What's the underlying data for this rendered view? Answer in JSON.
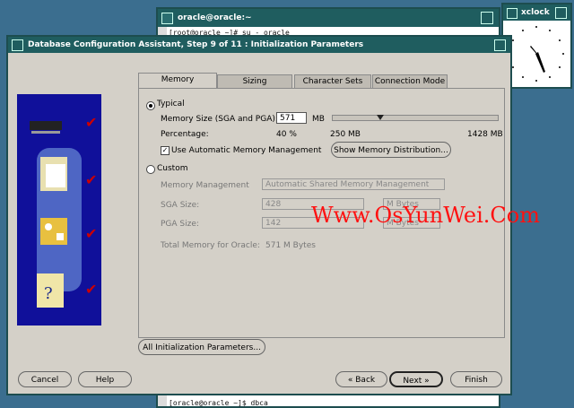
{
  "terminal": {
    "title": "oracle@oracle:~",
    "line1": "[root@oracle ~]# su - oracle",
    "prompt_line": "[oracle@oracle ~]$ dbca"
  },
  "xclock": {
    "title": "xclock"
  },
  "dbca": {
    "title": "Database Configuration Assistant, Step 9 of 11 : Initialization Parameters",
    "tabs": [
      "Memory",
      "Sizing",
      "Character Sets",
      "Connection Mode"
    ],
    "active_tab": "Memory",
    "typical": {
      "label": "Typical",
      "memory_size_label": "Memory Size (SGA and PGA):",
      "memory_size_value": "571",
      "memory_unit": "MB",
      "percentage_label": "Percentage:",
      "percent_value": "40 %",
      "min_mb": "250 MB",
      "max_mb": "1428 MB",
      "slider_level": 0.28,
      "use_amm_label": "Use Automatic Memory Management",
      "use_amm_checked": true,
      "show_dist_button": "Show Memory Distribution..."
    },
    "custom": {
      "label": "Custom",
      "memory_management_label": "Memory Management",
      "memory_management_value": "Automatic Shared Memory Management",
      "sga_label": "SGA Size:",
      "sga_value": "428",
      "sga_unit": "M Bytes",
      "pga_label": "PGA Size:",
      "pga_value": "142",
      "pga_unit": "M Bytes",
      "total_label": "Total Memory for Oracle:",
      "total_value": "571 M Bytes"
    },
    "all_params_button": "All Initialization Parameters...",
    "buttons": {
      "cancel": "Cancel",
      "help": "Help",
      "back": "Back",
      "next": "Next",
      "finish": "Finish"
    }
  },
  "watermark": "Www.OsYunWei.Com",
  "colors": {
    "title_bar": "#1f5d5f",
    "desktop": "#3b6e8f",
    "panel": "#d4d0c8",
    "image_panel": "#10109a",
    "watermark": "#ff1111"
  }
}
